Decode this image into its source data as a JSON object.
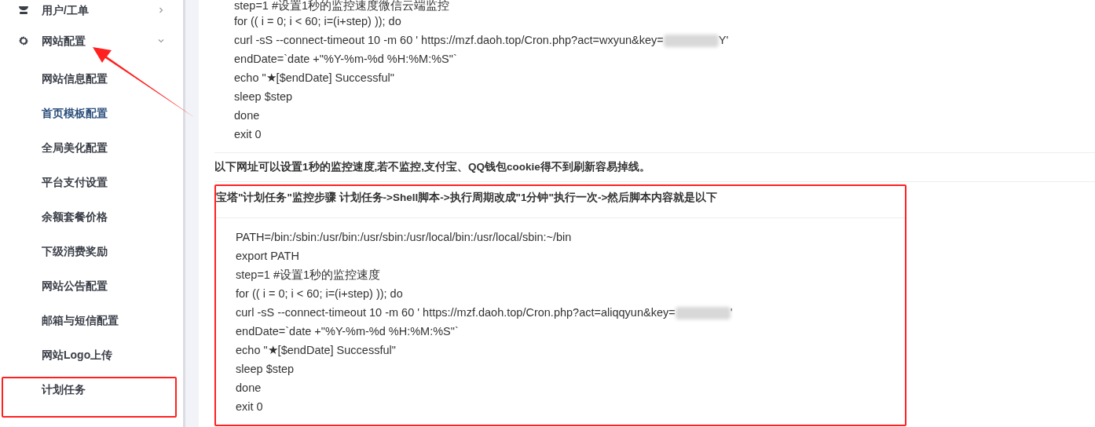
{
  "sidebar": {
    "items": [
      {
        "label": "用户/工单",
        "expanded": false
      },
      {
        "label": "网站配置",
        "expanded": true,
        "children": [
          {
            "label": "网站信息配置",
            "selected": false
          },
          {
            "label": "首页模板配置",
            "selected": true
          },
          {
            "label": "全局美化配置",
            "selected": false
          },
          {
            "label": "平台支付设置",
            "selected": false
          },
          {
            "label": "余额套餐价格",
            "selected": false
          },
          {
            "label": "下级消费奖励",
            "selected": false
          },
          {
            "label": "网站公告配置",
            "selected": false
          },
          {
            "label": "邮箱与短信配置",
            "selected": false
          },
          {
            "label": "网站Logo上传",
            "selected": false
          },
          {
            "label": "计划任务",
            "selected": false
          }
        ]
      }
    ]
  },
  "content": {
    "first_code": [
      {
        "text": "step=1 #设置1秒的监控速度微信云端监控"
      },
      {
        "text": "for (( i = 0; i < 60; i=(i+step) )); do"
      },
      {
        "text": "curl -sS --connect-timeout 10 -m 60 '  https://mzf.daoh.top/Cron.php?act=wxyun&key=",
        "redacted": true,
        "after": "Y'"
      },
      {
        "text": "endDate=`date +\"%Y-%m-%d %H:%M:%S\"`"
      },
      {
        "text": "echo \"★[$endDate] Successful\""
      },
      {
        "text": "sleep $step"
      },
      {
        "text": "done"
      },
      {
        "text": "exit 0"
      }
    ],
    "note": "以下网址可以设置1秒的监控速度,若不监控,支付宝、QQ钱包cookie得不到刷新容易掉线。",
    "heading": "宝塔\"计划任务\"监控步骤 计划任务->Shell脚本->执行周期改成\"1分钟\"执行一次->然后脚本内容就是以下",
    "second_code": [
      {
        "text": "PATH=/bin:/sbin:/usr/bin:/usr/sbin:/usr/local/bin:/usr/local/sbin:~/bin"
      },
      {
        "text": "export PATH"
      },
      {
        "text": "step=1 #设置1秒的监控速度"
      },
      {
        "text": "for (( i = 0; i < 60; i=(i+step) )); do"
      },
      {
        "text": "curl -sS --connect-timeout 10 -m 60 '  https://mzf.daoh.top/Cron.php?act=aliqqyun&key=",
        "redacted": true,
        "after": "'"
      },
      {
        "text": "endDate=`date +\"%Y-%m-%d %H:%M:%S\"`"
      },
      {
        "text": "echo \"★[$endDate] Successful\""
      },
      {
        "text": "sleep $step"
      },
      {
        "text": "done"
      },
      {
        "text": "exit 0"
      }
    ]
  }
}
